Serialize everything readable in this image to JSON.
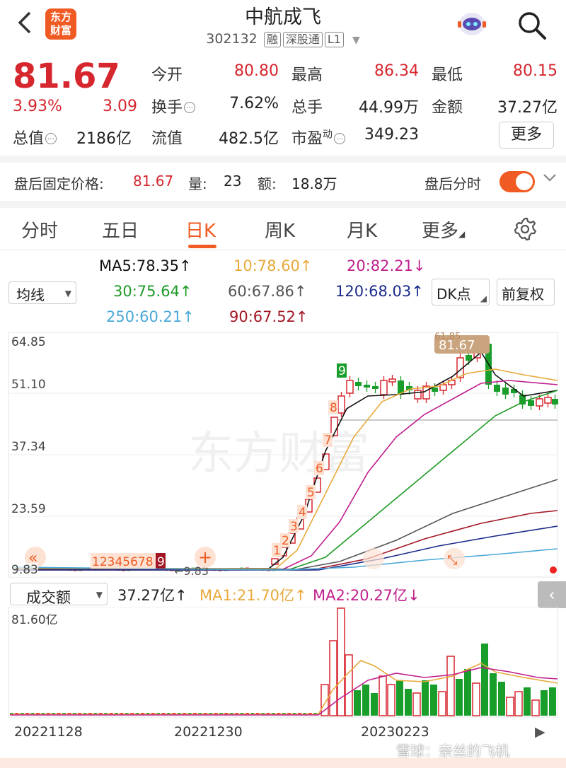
{
  "header": {
    "back_icon": "back-chevron-icon",
    "logo_text_1": "东方",
    "logo_text_2": "财富",
    "title": "中航成飞",
    "code": "302132",
    "tags": [
      "融",
      "深股通",
      "L1"
    ]
  },
  "quote": {
    "price": "81.67",
    "change_pct": "3.93%",
    "change": "3.09",
    "fields": [
      {
        "label": "今开",
        "value": "80.80"
      },
      {
        "label": "最高",
        "value": "86.34"
      },
      {
        "label": "最低",
        "value": "80.15"
      },
      {
        "label": "换手",
        "value": "7.62%"
      },
      {
        "label": "总手",
        "value": "44.99万"
      },
      {
        "label": "金额",
        "value": "37.27亿"
      },
      {
        "label": "流值",
        "value": "482.5亿"
      },
      {
        "label": "市盈",
        "label_sup": "动",
        "value": "349.23"
      }
    ],
    "total_value_label": "总值",
    "total_value": "2186亿",
    "more_button": "更多"
  },
  "after_hours": {
    "label": "盘后固定价格:",
    "price": "81.67",
    "vol_label": "量:",
    "vol": "23",
    "amt_label": "额:",
    "amt": "18.8万",
    "toggle_label": "盘后分时",
    "toggle_on": true
  },
  "tabs": [
    "分时",
    "五日",
    "日K",
    "周K",
    "月K",
    "更多"
  ],
  "active_tab": "日K",
  "ma": {
    "selector": "均线",
    "ma5": "MA5:78.35↑",
    "ma10": "10:78.60↑",
    "ma20": "20:82.21↓",
    "ma30": "30:75.64↑",
    "ma60": "60:67.86↑",
    "ma120": "120:68.03↑",
    "ma250": "250:60.21↑",
    "ma90": "90:67.52↑",
    "dk_button": "DK点",
    "fq_button": "前复权"
  },
  "colors": {
    "up": "#d6262e",
    "down": "#1a9e2b",
    "ma5": "#111111",
    "ma10": "#e8a93a",
    "ma20": "#c01f8e",
    "ma30": "#1e9a27",
    "ma60": "#555555",
    "ma90": "#a31624",
    "ma120": "#1a2a8a",
    "ma250": "#4aa8d8",
    "accent": "#ef5b22"
  },
  "kchart": {
    "y_labels": [
      "64.85",
      "51.10",
      "37.34",
      "23.59",
      "9.83"
    ],
    "min_marker": "←9.83",
    "price_tag": "81.67",
    "high_tag": "61.85",
    "watermark": "东方财富",
    "td_labels": [
      "1",
      "2",
      "3",
      "4",
      "5",
      "6",
      "7",
      "8",
      "9"
    ],
    "td_row": "12345678",
    "td_row_last": "9"
  },
  "volume": {
    "selector": "成交额",
    "value": "37.27亿↑",
    "ma1": "MA1:21.70亿↑",
    "ma2": "MA2:20.27亿↓",
    "y_label": "81.60亿"
  },
  "dates": [
    "20221128",
    "20221230",
    "20230223"
  ],
  "footer_watermark": "雪球：奈丝的飞机",
  "chart_data": {
    "type": "candlestick",
    "ylim": [
      9.83,
      64.85
    ],
    "y_ticks": [
      64.85,
      51.1,
      37.34,
      23.59,
      9.83
    ],
    "x_ticks": [
      "20221128",
      "20221230",
      "20230223"
    ]
  }
}
